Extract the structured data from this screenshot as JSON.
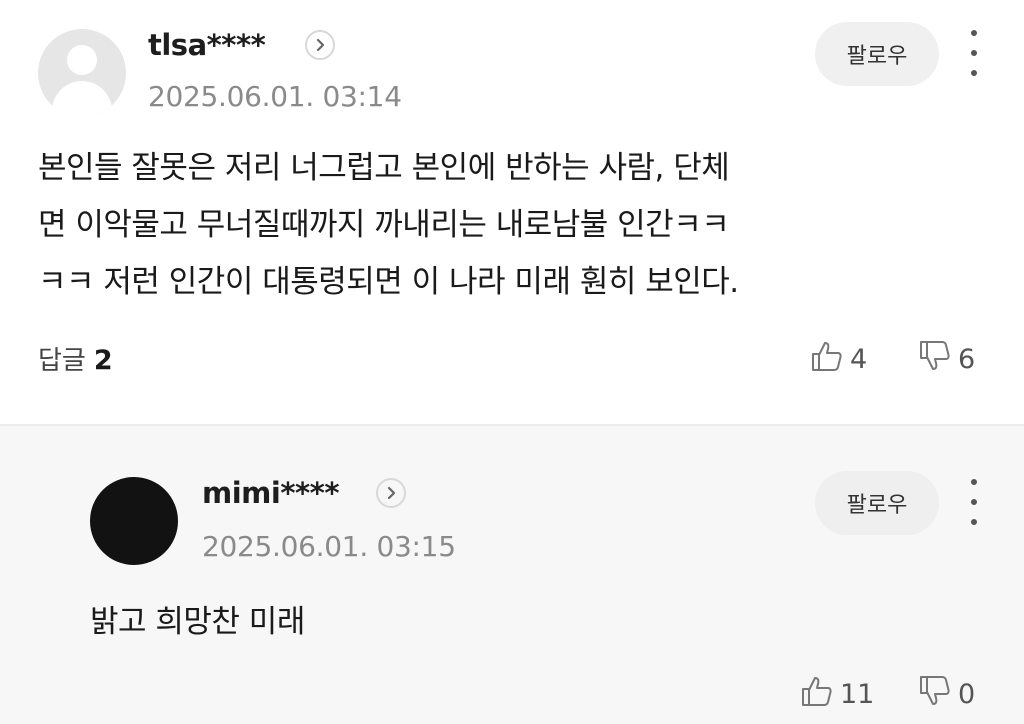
{
  "comments": [
    {
      "username": "tlsa****",
      "timestamp": "2025.06.01. 03:14",
      "follow_label": "팔로우",
      "text_lines": [
        "본인들 잘못은 저리 너그럽고 본인에 반하는 사람, 단체",
        "면 이악물고 무너질때까지 까내리는 내로남불 인간ㅋㅋ",
        "ㅋㅋ 저런 인간이 대통령되면 이 나라 미래 훤히 보인다."
      ],
      "reply_label": "답글",
      "reply_count": "2",
      "likes": "4",
      "dislikes": "6"
    },
    {
      "username": "mimi****",
      "timestamp": "2025.06.01. 03:15",
      "follow_label": "팔로우",
      "text_lines": [
        "밝고 희망찬 미래"
      ],
      "likes": "11",
      "dislikes": "0"
    }
  ],
  "icons": {
    "profile_chevron": "chevron-right-icon",
    "more": "more-vertical-icon",
    "like": "thumbs-up-icon",
    "dislike": "thumbs-down-icon",
    "default_avatar": "user-placeholder-icon"
  },
  "colors": {
    "background": "#ffffff",
    "reply_background": "#f7f7f7",
    "follow_button": "#f0f0f0",
    "muted_text": "#8a8a8a"
  }
}
